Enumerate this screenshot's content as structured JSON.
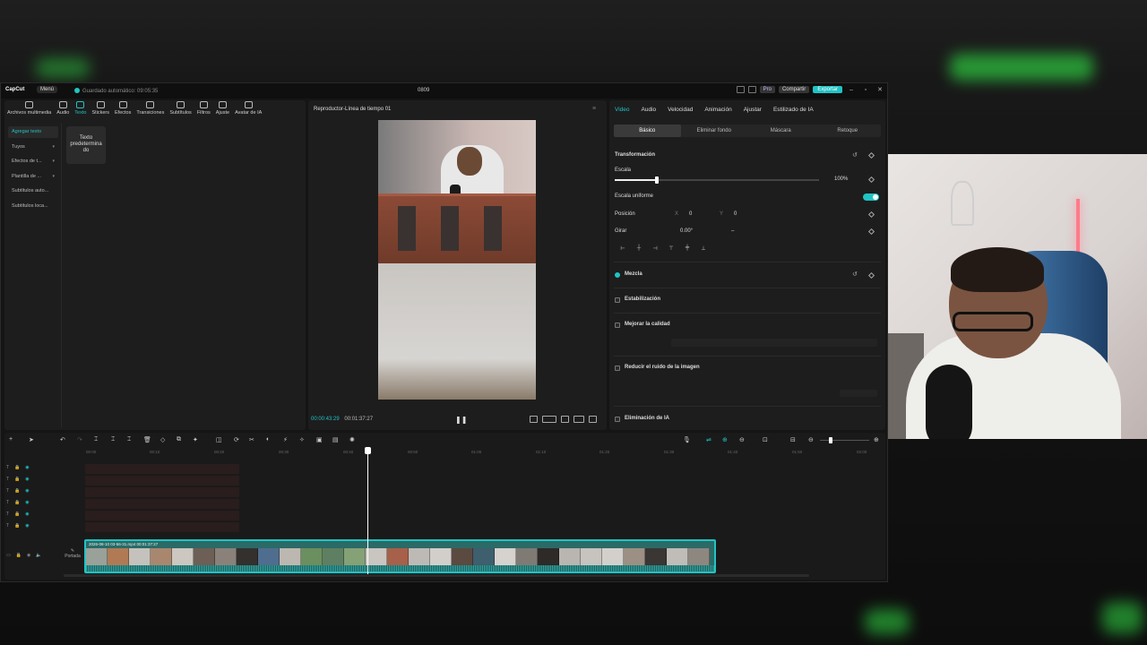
{
  "titlebar": {
    "logo": "CapCut",
    "menu": "Menú",
    "autosave": "Guardado automático: 09:05:35",
    "doc_title": "0809",
    "pro": "Pro",
    "share": "Compartir",
    "export": "Exportar"
  },
  "toolbar": {
    "items": [
      {
        "label": "Archivos multimedia",
        "icon": "media-icon"
      },
      {
        "label": "Audio",
        "icon": "audio-icon"
      },
      {
        "label": "Texto",
        "icon": "text-icon"
      },
      {
        "label": "Stickers",
        "icon": "sticker-icon"
      },
      {
        "label": "Efectos",
        "icon": "effects-icon"
      },
      {
        "label": "Transiciones",
        "icon": "transition-icon"
      },
      {
        "label": "Subtítulos",
        "icon": "subtitle-icon"
      },
      {
        "label": "Filtros",
        "icon": "filter-icon"
      },
      {
        "label": "Ajuste",
        "icon": "adjust-icon"
      },
      {
        "label": "Avatar de IA",
        "icon": "avatar-icon"
      }
    ]
  },
  "sidemenu": {
    "items": [
      "Agregar texto",
      "Tuyos",
      "Efectos de t...",
      "Plantilla de ...",
      "Subtítulos auto...",
      "Subtítulos loca..."
    ]
  },
  "card": {
    "label_1": "Texto",
    "label_2": "predetermina",
    "label_3": "do"
  },
  "player": {
    "title": "Reproductor-Línea de tiempo 01",
    "current_time": "00:00:43:29",
    "total_time": "00:01:37:27"
  },
  "props": {
    "tabs": [
      "Video",
      "Audio",
      "Velocidad",
      "Animación",
      "Ajustar",
      "Estilizado de IA"
    ],
    "subtabs": [
      "Básico",
      "Eliminar fondo",
      "Máscara",
      "Retoque"
    ],
    "transform": "Transformación",
    "scale": "Escala",
    "scale_value": "100%",
    "scale_level": 0.2,
    "uniform_scale": "Escala uniforme",
    "position": "Posición",
    "x_label": "X",
    "x_value": "0",
    "y_label": "Y",
    "y_value": "0",
    "rotate": "Girar",
    "rotate_value": "0.00°",
    "rotate_dash": "–",
    "blend": "Mezcla",
    "stabilize": "Estabilización",
    "enhance": "Mejorar la calidad",
    "noise": "Reducir el ruido de la imagen",
    "removal": "Eliminación de IA"
  },
  "timeline": {
    "ruler": [
      "00:00",
      "00:10",
      "00:20",
      "00:30",
      "00:40",
      "00:50",
      "01:00",
      "01:10",
      "01:20",
      "01:30",
      "01:40",
      "01:50",
      "02:00"
    ],
    "clip_label": "2026-08-10 03-56-31.mp4   00:01:37:27",
    "cover": "Portada"
  },
  "colors": {
    "accent": "#21c3c4"
  }
}
